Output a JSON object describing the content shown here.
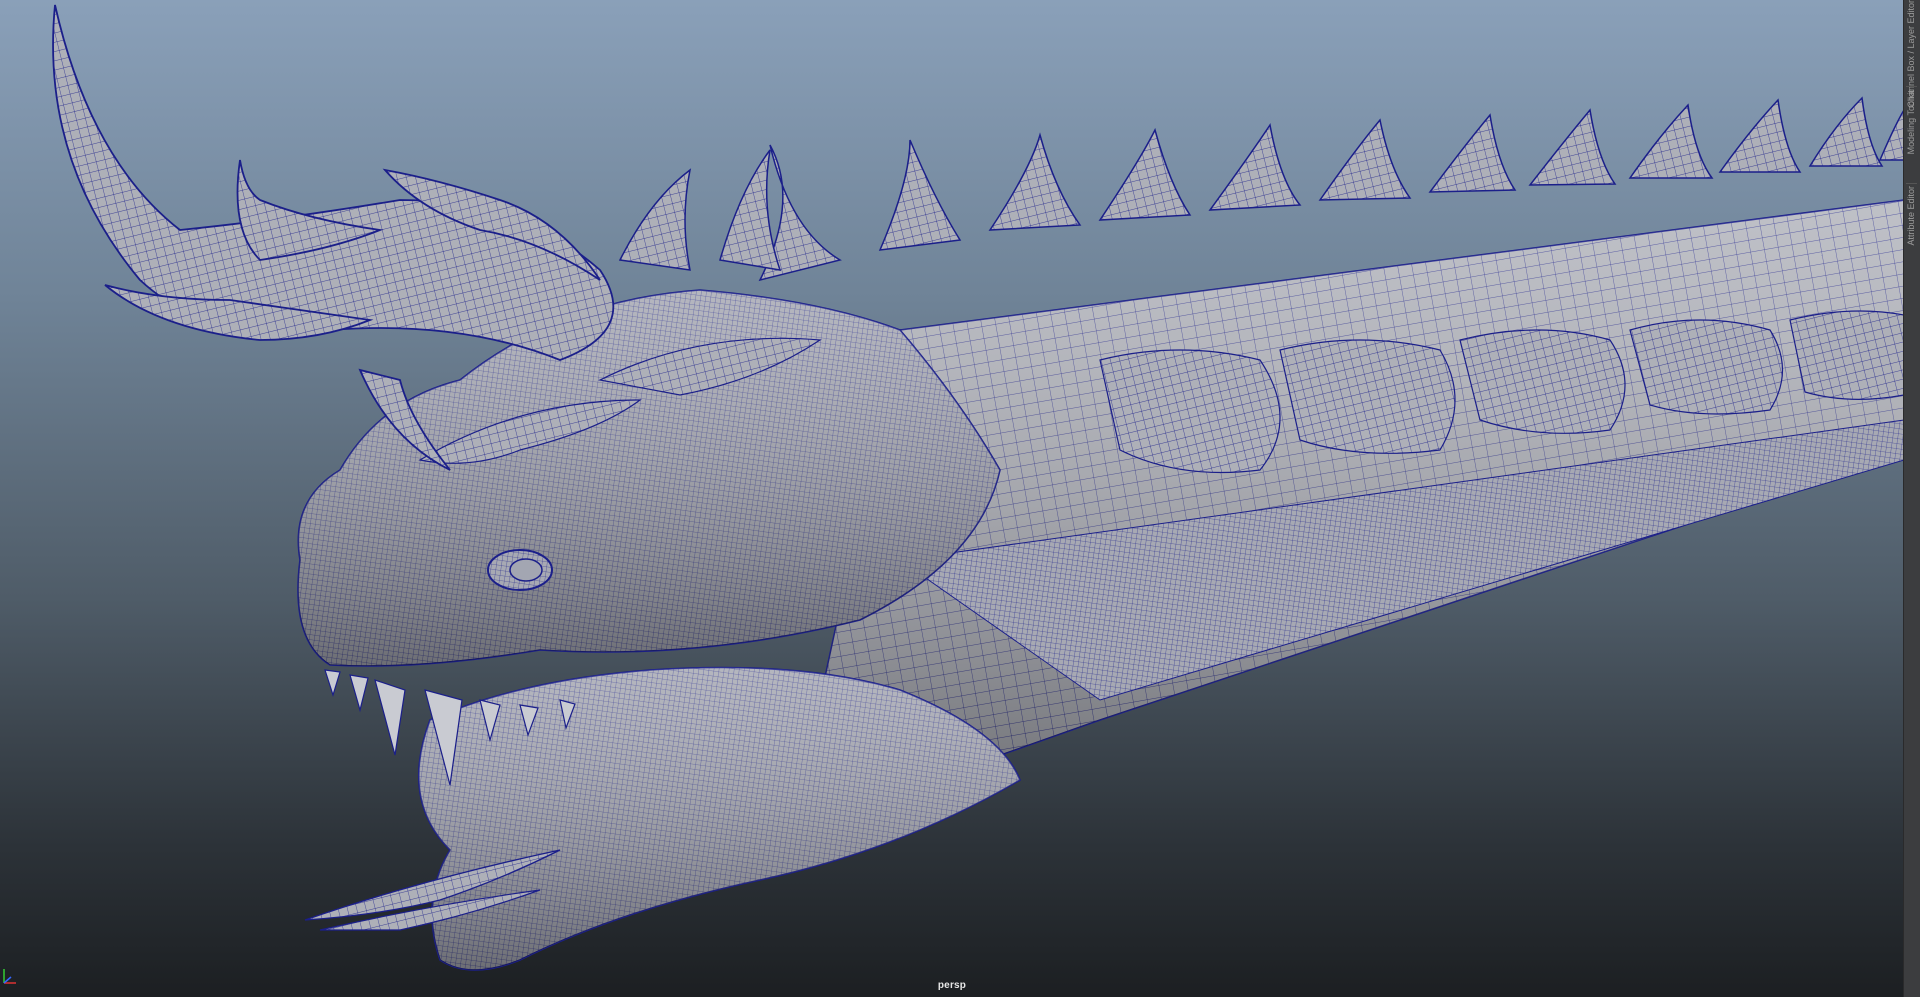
{
  "viewport": {
    "camera_label": "persp",
    "background_top": "#8aa0b9",
    "background_bottom": "#1c1f22",
    "mesh_fill": "#aeb0b8",
    "wire_color": "#1b1f8a",
    "subject": "dragon-wireframe-mesh"
  },
  "right_panel": {
    "tabs": [
      {
        "label": "Channel Box / Layer Editor"
      },
      {
        "label": "Modeling Toolkit"
      },
      {
        "label": "Attribute Editor"
      }
    ]
  },
  "gizmo": {
    "x_color": "#d33",
    "y_color": "#3c3",
    "z_color": "#36f"
  }
}
